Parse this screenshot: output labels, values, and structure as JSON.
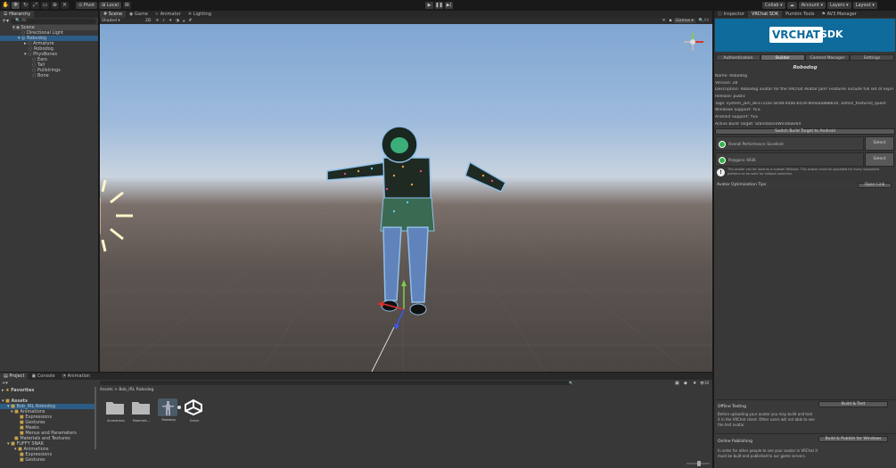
{
  "toolbar": {
    "pivot": "Pivot",
    "local": "Local",
    "collab": "Collab",
    "account": "Account",
    "layers": "Layers",
    "layout": "Layout"
  },
  "hierarchy": {
    "tab": "Hierarchy",
    "search_placeholder": "All",
    "items": [
      {
        "label": "Scene"
      },
      {
        "label": "Directional Light"
      },
      {
        "label": "Robodog"
      },
      {
        "label": "Armature"
      },
      {
        "label": "Robodog"
      },
      {
        "label": "PhysBones"
      },
      {
        "label": "Ears"
      },
      {
        "label": "Tail"
      },
      {
        "label": "Pullstrings"
      },
      {
        "label": "Bone"
      }
    ]
  },
  "scene_tabs": [
    "Scene",
    "Game",
    "Animator",
    "Lighting"
  ],
  "scene_toolbar": {
    "shading": "Shaded",
    "mode2d": "2D",
    "gizmos": "Gizmos",
    "search": "All"
  },
  "inspector_tabs": [
    "Inspector",
    "VRChat SDK",
    "Pumkin Tools",
    "AV3 Manager"
  ],
  "sdk": {
    "logo_left": "VR",
    "logo_mid": "CHAT",
    "logo_right": "SDK",
    "tabs": [
      "Authentication",
      "Builder",
      "Content Manager",
      "Settings"
    ],
    "avatar_title": "Robodog",
    "info": [
      "Name: Robodog",
      "Version: 28",
      "Description: Robodog avatar for the VRChat Avatar Jam! Features include full set of express",
      "Release: public",
      "Tags: system_jam_8e3721bc-8c08-4da6-b5c8-9e0aaa888830, admin_featured_quest",
      "Windows Support: YES",
      "Android Support: YES",
      "Active Build Target: StandaloneWindows64"
    ],
    "switch_button": "Switch Build Target to Android",
    "perf_overall": "Overall Performance: Excellent",
    "perf_polygons": "Polygons: 6936",
    "select_label": "Select",
    "fallback_note": "This avatar can be used as a custom Fallback. This avatar must be uploaded for every supported platform to be valid for fallback selection.",
    "optimization_tips": "Avatar Optimization Tips",
    "open_link": "Open Link",
    "offline_title": "Offline Testing",
    "offline_desc": "Before uploading your avatar you may build and test it in the VRChat client. Other users will not able to see the test avatar.",
    "build_test": "Build & Test",
    "online_title": "Online Publishing",
    "online_desc": "In order for other people to see your avatar in VRChat it must be built and published to our game servers.",
    "build_publish": "Build & Publish for Windows"
  },
  "project": {
    "tabs": [
      "Project",
      "Console",
      "Animation"
    ],
    "favorites": "Favorites",
    "tree": [
      {
        "label": "Assets"
      },
      {
        "label": "Bob_IRL Robodog"
      },
      {
        "label": "Animations"
      },
      {
        "label": "Expressions"
      },
      {
        "label": "Gestures"
      },
      {
        "label": "Masks"
      },
      {
        "label": "Menus and Parameters"
      },
      {
        "label": "Materials and Textures"
      },
      {
        "label": "FUFFY SNAK"
      },
      {
        "label": "Animations"
      },
      {
        "label": "Expressions"
      },
      {
        "label": "Gestures"
      }
    ],
    "breadcrumb_root": "Assets",
    "breadcrumb_sep": ">",
    "breadcrumb_folder": "Bob_IRL Robodog",
    "assets": [
      {
        "label": "Animations",
        "icon": "folder-icon"
      },
      {
        "label": "Materials ...",
        "icon": "folder-icon"
      },
      {
        "label": "Robodog",
        "icon": "model-icon"
      },
      {
        "label": "Scene",
        "icon": "unity-scene-icon"
      }
    ],
    "count": "10"
  }
}
